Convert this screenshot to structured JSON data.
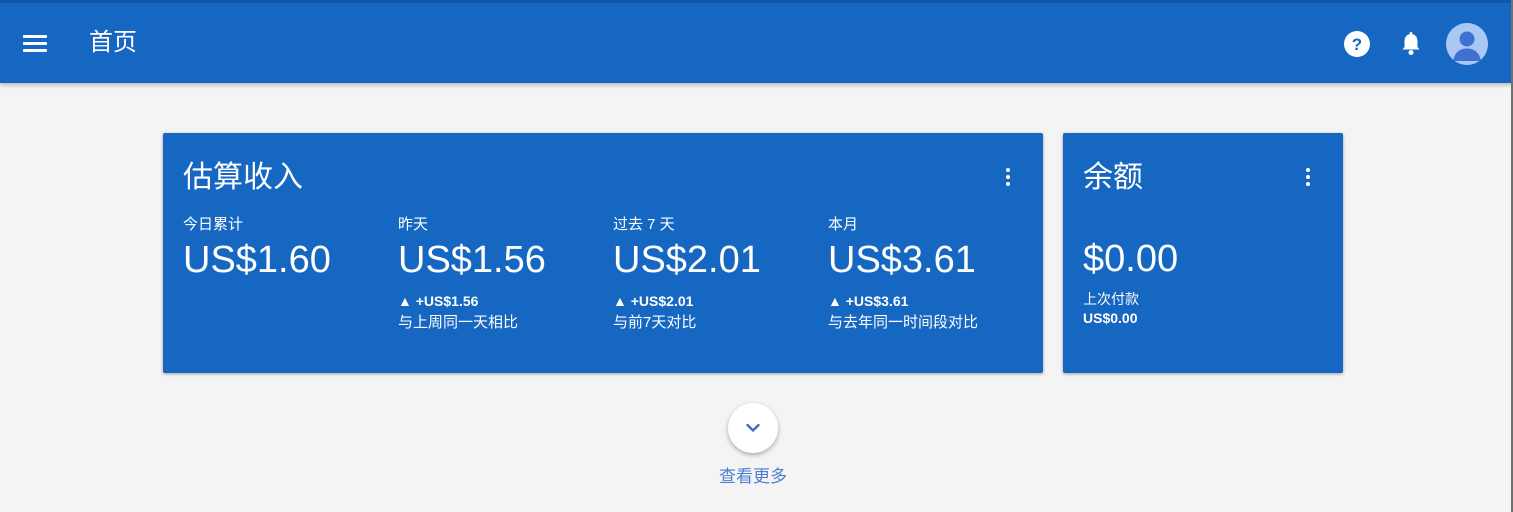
{
  "header": {
    "title": "首页",
    "menu_icon": "menu-icon",
    "help_icon": "help-icon",
    "notification_icon": "bell-icon",
    "avatar_icon": "account-avatar-icon",
    "color": "#1667c2"
  },
  "earnings": {
    "title": "估算收入",
    "menu_icon": "more-vert-icon",
    "metrics": [
      {
        "label": "今日累计",
        "value": "US$1.60",
        "delta": "",
        "compare": ""
      },
      {
        "label": "昨天",
        "value": "US$1.56",
        "delta": "▲ +US$1.56",
        "compare": "与上周同一天相比"
      },
      {
        "label": "过去 7 天",
        "value": "US$2.01",
        "delta": "▲ +US$2.01",
        "compare": "与前7天对比"
      },
      {
        "label": "本月",
        "value": "US$3.61",
        "delta": "▲ +US$3.61",
        "compare": "与去年同一时间段对比"
      }
    ]
  },
  "balance": {
    "title": "余额",
    "menu_icon": "more-vert-icon",
    "value": "$0.00",
    "last_payment_label": "上次付款",
    "last_payment_value": "US$0.00"
  },
  "footer": {
    "expand_icon": "chevron-down-icon",
    "more_label": "查看更多",
    "link_color": "#4a7fcf"
  }
}
